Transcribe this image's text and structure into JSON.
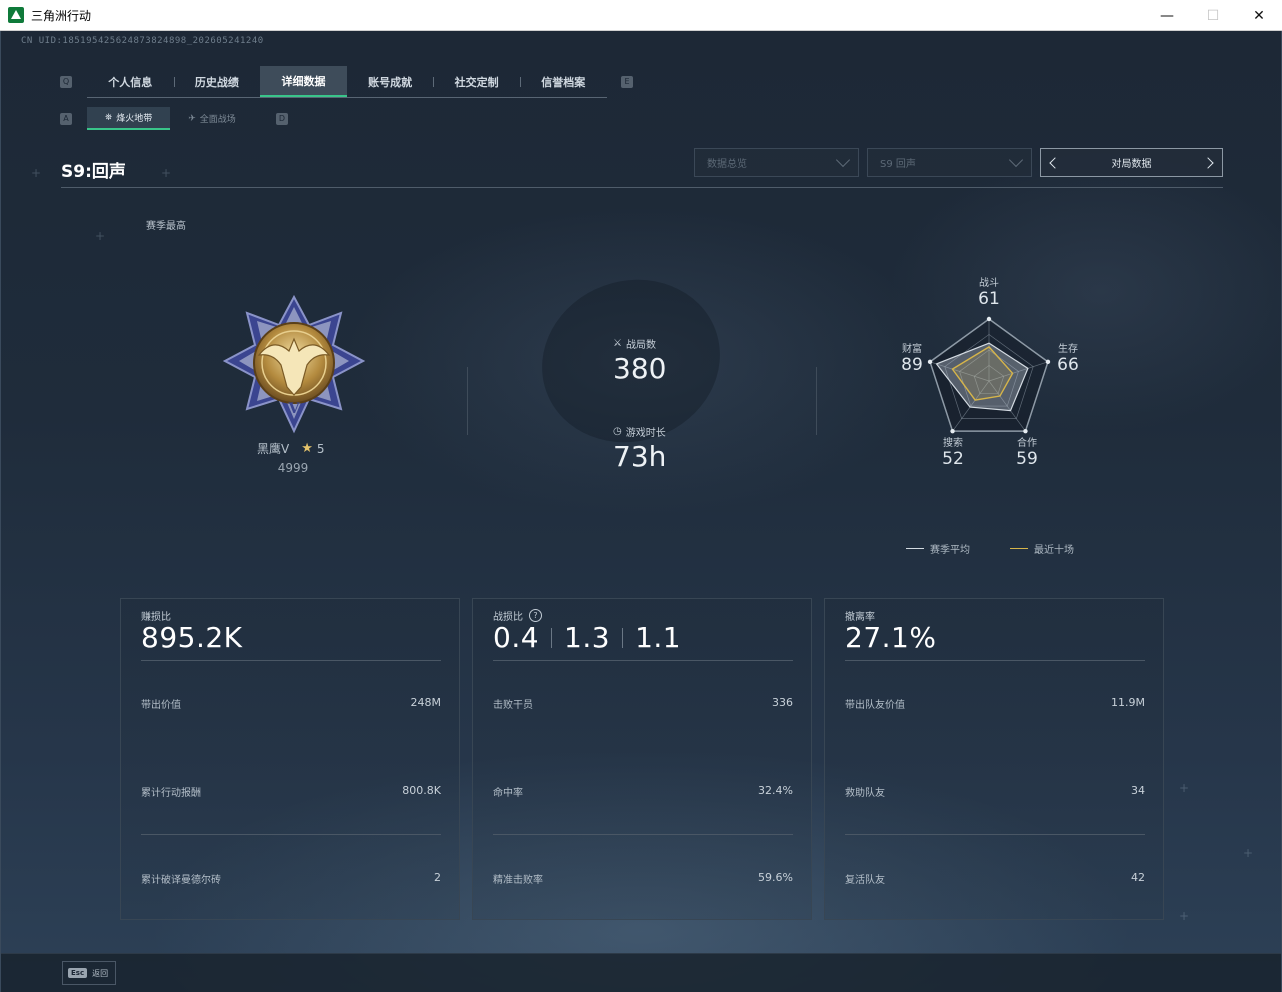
{
  "window": {
    "title": "三角洲行动",
    "minimize": "—",
    "maximize": "☐",
    "close": "✕"
  },
  "uid": "CN UID:18519542562487382489​8_202605241240",
  "tabs": [
    {
      "label": "个人信息",
      "active": false
    },
    {
      "label": "历史战绩",
      "active": false
    },
    {
      "label": "详细数据",
      "active": true
    },
    {
      "label": "账号成就",
      "active": false
    },
    {
      "label": "社交定制",
      "active": false
    },
    {
      "label": "信誉档案",
      "active": false
    }
  ],
  "key_hints": {
    "tab_prev": "Q",
    "tab_next": "E",
    "sub_prev": "A",
    "sub_next": "D"
  },
  "subtabs": [
    {
      "label": "烽火地带",
      "active": true
    },
    {
      "label": "全面战场",
      "active": false
    }
  ],
  "season": {
    "title": "S9:回声",
    "best_label": "赛季最高"
  },
  "filters": {
    "dropdown1": "数据总览",
    "dropdown2": "S9 回声",
    "pager_label": "对局数据"
  },
  "rank": {
    "name": "黑鹰V",
    "stars": "5",
    "score": "4999"
  },
  "matches": {
    "label": "战局数",
    "value": "380"
  },
  "playtime": {
    "label": "游戏时长",
    "value": "73h"
  },
  "radar": {
    "axes": [
      {
        "label": "战斗",
        "value": 61
      },
      {
        "label": "生存",
        "value": 66
      },
      {
        "label": "合作",
        "value": 59
      },
      {
        "label": "搜索",
        "value": 52
      },
      {
        "label": "财富",
        "value": 89
      }
    ],
    "recent": [
      55,
      40,
      30,
      38,
      62
    ],
    "legend": [
      {
        "label": "赛季平均",
        "color": "#d4dbe2"
      },
      {
        "label": "最近十场",
        "color": "#d6b54a"
      }
    ]
  },
  "panels": [
    {
      "title": "赚损比",
      "values": [
        "895.2K"
      ],
      "rows": [
        {
          "label": "带出价值",
          "value": "248M"
        },
        {
          "label": "累计行动报酬",
          "value": "800.8K"
        },
        {
          "label": "累计破译曼德尔砖",
          "value": "2"
        }
      ]
    },
    {
      "title": "战损比",
      "help": "?",
      "values": [
        "0.4",
        "1.3",
        "1.1"
      ],
      "rows": [
        {
          "label": "击败干员",
          "value": "336"
        },
        {
          "label": "命中率",
          "value": "32.4%"
        },
        {
          "label": "精准击败率",
          "value": "59.6%"
        }
      ]
    },
    {
      "title": "撤离率",
      "values": [
        "27.1%"
      ],
      "rows": [
        {
          "label": "带出队友价值",
          "value": "11.9M"
        },
        {
          "label": "救助队友",
          "value": "34"
        },
        {
          "label": "复活队友",
          "value": "42"
        }
      ]
    }
  ],
  "footer": {
    "esc_key": "Esc",
    "esc_label": "返回"
  },
  "colors": {
    "accent": "#39c58a",
    "gold": "#d6b54a"
  }
}
